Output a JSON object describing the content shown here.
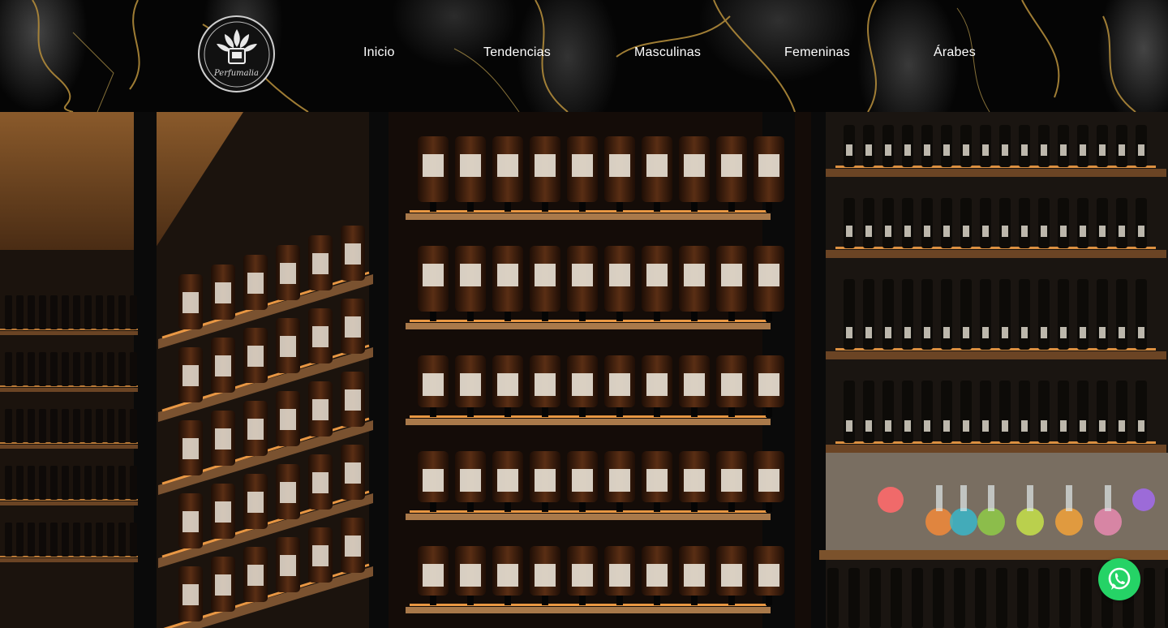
{
  "brand": {
    "wordmark": "Perfumalia",
    "accent": "#c9a24a"
  },
  "nav": {
    "items": [
      "Inicio",
      "Tendencias",
      "Masculinas",
      "Femeninas",
      "Árabes"
    ]
  },
  "hero": {
    "image": "perfume-shelves-photo",
    "accent_light": "#ffa64a",
    "glass_color": "#3a1e0e"
  },
  "floating": {
    "whatsapp_icon": "whatsapp-icon",
    "whatsapp_color": "#25d366"
  }
}
